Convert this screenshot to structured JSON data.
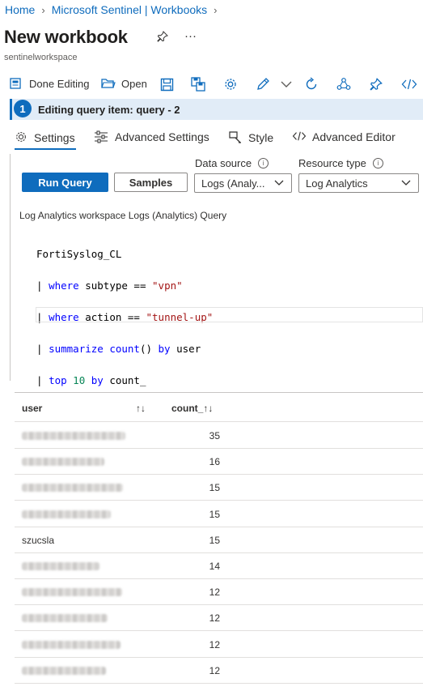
{
  "breadcrumb": {
    "home": "Home",
    "workbooks": "Microsoft Sentinel | Workbooks"
  },
  "header": {
    "title": "New workbook",
    "workspace": "sentinelworkspace",
    "more": "···"
  },
  "toolbar": {
    "done_editing": "Done Editing",
    "open": "Open"
  },
  "edit_banner": {
    "step": "1",
    "text": "Editing query item: query - 2"
  },
  "tabs": [
    {
      "label": "Settings",
      "icon": "gear-icon",
      "selected": true
    },
    {
      "label": "Advanced Settings",
      "icon": "sliders-icon",
      "selected": false
    },
    {
      "label": "Style",
      "icon": "brush-icon",
      "selected": false
    },
    {
      "label": "Advanced Editor",
      "icon": "code-icon",
      "selected": false
    }
  ],
  "query_panel": {
    "run_query": "Run Query",
    "samples": "Samples",
    "data_source_label": "Data source",
    "data_source_value": "Logs (Analy...",
    "resource_type_label": "Resource type",
    "resource_type_value": "Log Analytics",
    "query_label": "Log Analytics workspace Logs (Analytics) Query"
  },
  "query": {
    "line1": "FortiSyslog_CL",
    "line2_kw": "where",
    "line2_field": " subtype == ",
    "line2_str": "\"vpn\"",
    "line3_kw": "where",
    "line3_field": " action == ",
    "line3_str": "\"tunnel-up\"",
    "line4_kw": "summarize",
    "line4_fn": " count",
    "line4_rest": "() ",
    "line4_by": "by",
    "line4_field": " user",
    "line5_kw": "top",
    "line5_num": " 10",
    "line5_by": " by",
    "line5_field": " count_",
    "pipe": "|"
  },
  "results": {
    "columns": [
      "user",
      "count_"
    ],
    "sort_glyph": "↑↓",
    "rows": [
      {
        "user": "",
        "count": "35",
        "redacted": true
      },
      {
        "user": "",
        "count": "16",
        "redacted": true
      },
      {
        "user": "",
        "count": "15",
        "redacted": true
      },
      {
        "user": "",
        "count": "15",
        "redacted": true
      },
      {
        "user": "szucsla",
        "count": "15",
        "redacted": false
      },
      {
        "user": "",
        "count": "14",
        "redacted": true
      },
      {
        "user": "",
        "count": "12",
        "redacted": true
      },
      {
        "user": "",
        "count": "12",
        "redacted": true
      },
      {
        "user": "",
        "count": "12",
        "redacted": true
      },
      {
        "user": "",
        "count": "12",
        "redacted": true
      }
    ]
  },
  "colors": {
    "accent": "#0f6cbd",
    "banner_bg": "#e1ecf7",
    "keyword": "#0000ff",
    "string": "#a31515",
    "number": "#098658"
  }
}
